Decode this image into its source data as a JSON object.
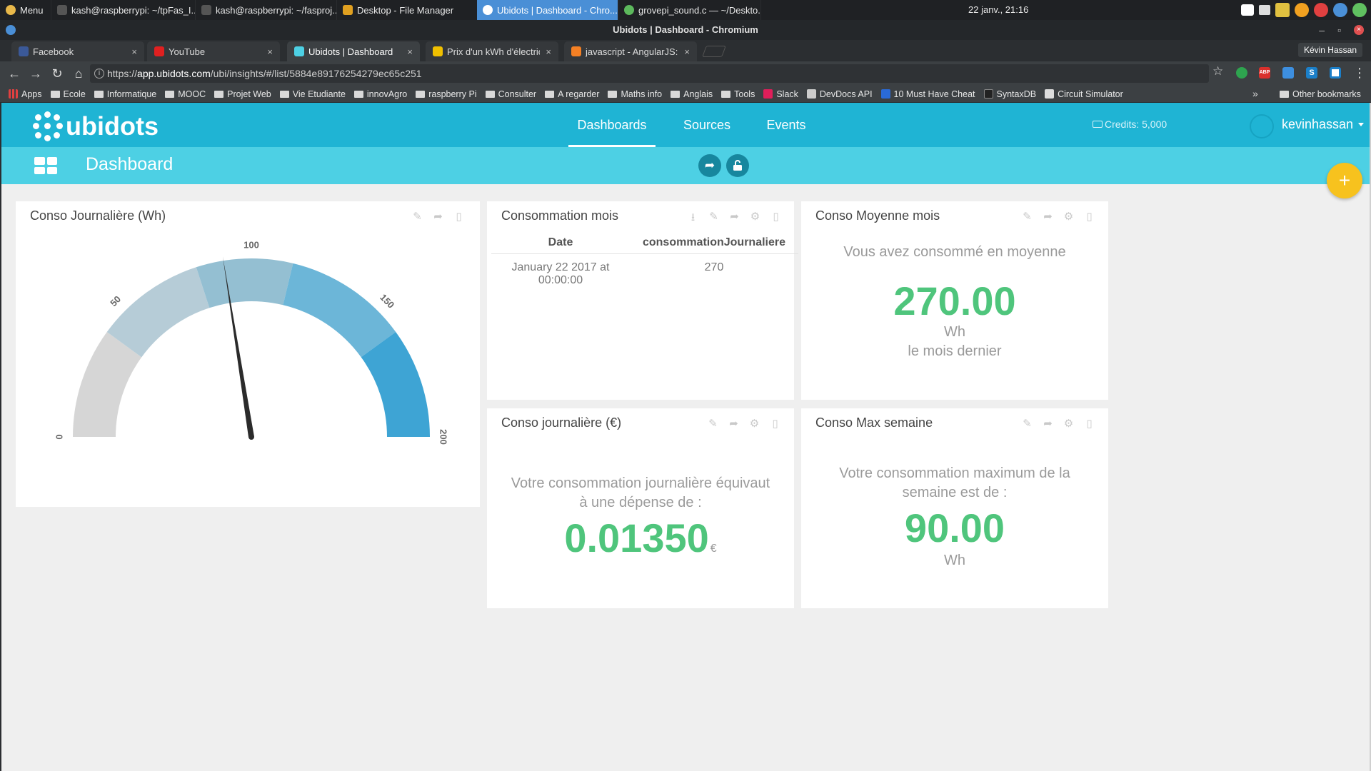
{
  "taskbar": {
    "items": [
      {
        "label": "Menu",
        "color": "#e8b84a"
      },
      {
        "label": "kash@raspberrypi: ~/tpFas_I...",
        "color": "#555555"
      },
      {
        "label": "kash@raspberrypi: ~/fasproj...",
        "color": "#555555"
      },
      {
        "label": "Desktop - File Manager",
        "color": "#e0a020"
      },
      {
        "label": "Ubidots | Dashboard - Chro...",
        "color": "#4a8fd6"
      },
      {
        "label": "grovepi_sound.c — ~/Deskto...",
        "color": "#5cb85c"
      }
    ],
    "clock": "22 janv., 21:16",
    "tray_colors": [
      "#ffffff",
      "#dddddd",
      "#e0c040",
      "#f0a020",
      "#e04040",
      "#4a8fd6",
      "#60c060"
    ]
  },
  "window": {
    "title": "Ubidots | Dashboard - Chromium",
    "controls": {
      "minimize": "–",
      "restore": "▫",
      "close": "×"
    },
    "profile": "Kévin Hassan"
  },
  "tabs": [
    {
      "title": "Facebook",
      "icon": "facebook-icon",
      "color": "#3b5998",
      "close": "×"
    },
    {
      "title": "YouTube",
      "icon": "youtube-icon",
      "color": "#e02020",
      "close": "×"
    },
    {
      "title": "Ubidots | Dashboard",
      "icon": "ubidots-icon",
      "color": "#4dd0e4",
      "close": "×"
    },
    {
      "title": "Prix d'un kWh d'électric",
      "icon": "bolt-icon",
      "color": "#f0c000",
      "close": "×"
    },
    {
      "title": "javascript - AngularJS: M",
      "icon": "stackoverflow-icon",
      "color": "#f48024",
      "close": "×"
    }
  ],
  "toolbar": {
    "back": "←",
    "forward": "→",
    "reload": "↻",
    "home": "⌂",
    "star": "☆",
    "url_prefix": "https://",
    "url_host": "app.ubidots.com",
    "url_path": "/ubi/insights/#/list/5884e89176254279ec65c251",
    "extensions": [
      "#2ea44f",
      "#d9302c",
      "#3d8fe0",
      "#1b7fc9",
      "#ffffff"
    ],
    "ext_labels": [
      "",
      "ABP",
      "",
      "S",
      ""
    ]
  },
  "bookmarks": {
    "items": [
      {
        "label": "Apps",
        "type": "apps"
      },
      {
        "label": "Ecole",
        "type": "folder"
      },
      {
        "label": "Informatique",
        "type": "folder"
      },
      {
        "label": "MOOC",
        "type": "folder"
      },
      {
        "label": "Projet Web",
        "type": "folder"
      },
      {
        "label": "Vie Etudiante",
        "type": "folder"
      },
      {
        "label": "innovAgro",
        "type": "folder"
      },
      {
        "label": "raspberry Pi",
        "type": "folder"
      },
      {
        "label": "Consulter",
        "type": "folder"
      },
      {
        "label": "A regarder",
        "type": "folder"
      },
      {
        "label": "Maths info",
        "type": "folder"
      },
      {
        "label": "Anglais",
        "type": "folder"
      },
      {
        "label": "Tools",
        "type": "folder"
      },
      {
        "label": "Slack",
        "type": "link",
        "color": "#e01e5a"
      },
      {
        "label": "DevDocs API",
        "type": "link",
        "color": "#cccccc"
      },
      {
        "label": "10 Must Have Cheat",
        "type": "link",
        "color": "#2a6ad8"
      },
      {
        "label": "SyntaxDB",
        "type": "link",
        "color": "#222222"
      },
      {
        "label": "Circuit Simulator",
        "type": "link",
        "color": "#dddddd"
      }
    ],
    "more": "»",
    "other": "Other bookmarks"
  },
  "app": {
    "logo": "ubidots",
    "nav": [
      "Dashboards",
      "Sources",
      "Events"
    ],
    "credits": "Credits: 5,000",
    "username": "kevinhassan",
    "dashboard_title": "Dashboard",
    "fab": "+"
  },
  "widgets": {
    "gauge": {
      "title": "Conso Journalière (Wh)",
      "min": 0,
      "max": 200,
      "ticks": [
        "0",
        "50",
        "100",
        "150",
        "200"
      ],
      "value": 90,
      "band_colors": [
        "#d6d6d6",
        "#b6ccd7",
        "#94bfd2",
        "#6cb6d8",
        "#3ea4d4"
      ]
    },
    "table": {
      "title": "Consommation mois",
      "headers": [
        "Date",
        "consommationJournaliere"
      ],
      "rows": [
        {
          "date_line1": "January 22 2017 at",
          "date_line2": "00:00:00",
          "value": "270"
        }
      ]
    },
    "avg": {
      "title": "Conso Moyenne mois",
      "line1": "Vous avez consommé en moyenne",
      "value": "270.00",
      "unit": "Wh",
      "line2": "le mois dernier"
    },
    "cost": {
      "title": "Conso journalière (€)",
      "line1": "Votre consommation journalière équivaut",
      "line2": "à une dépense de :",
      "value": "0.01350",
      "unit": "€"
    },
    "max": {
      "title": "Conso Max semaine",
      "line1": "Votre consommation maximum de la",
      "line2": "semaine est de :",
      "value": "90.00",
      "unit": "Wh"
    }
  },
  "widget_icons": {
    "download": "⭳",
    "edit": "✎",
    "share": "➦",
    "settings": "⚙",
    "delete": "🗑"
  }
}
